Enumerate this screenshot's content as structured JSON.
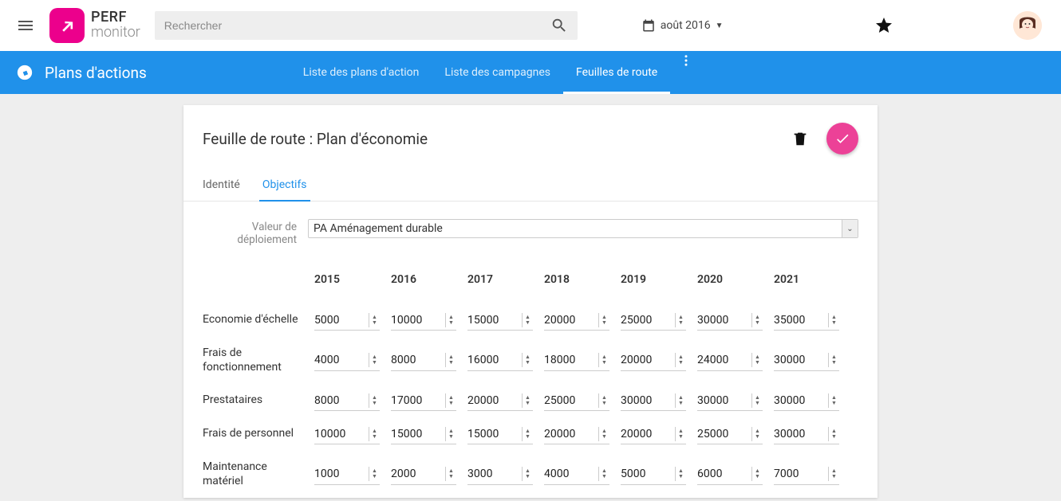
{
  "topbar": {
    "logo_line1": "PERF",
    "logo_line2": "monitor",
    "search_placeholder": "Rechercher",
    "date_label": "août 2016"
  },
  "navbar": {
    "title": "Plans d'actions",
    "tabs": [
      {
        "label": "Liste des plans d'action",
        "active": false
      },
      {
        "label": "Liste des campagnes",
        "active": false
      },
      {
        "label": "Feuilles de route",
        "active": true
      }
    ]
  },
  "card": {
    "title": "Feuille de route : Plan d'économie",
    "tabs": [
      {
        "label": "Identité",
        "active": false
      },
      {
        "label": "Objectifs",
        "active": true
      }
    ],
    "deployment_label": "Valeur de déploiement",
    "deployment_value": "PA Aménagement durable"
  },
  "table": {
    "years": [
      "2015",
      "2016",
      "2017",
      "2018",
      "2019",
      "2020",
      "2021"
    ],
    "rows": [
      {
        "label": "Economie d'échelle",
        "values": [
          "5000",
          "10000",
          "15000",
          "20000",
          "25000",
          "30000",
          "35000"
        ]
      },
      {
        "label": "Frais de fonctionnement",
        "values": [
          "4000",
          "8000",
          "16000",
          "18000",
          "20000",
          "24000",
          "30000"
        ]
      },
      {
        "label": "Prestataires",
        "values": [
          "8000",
          "17000",
          "20000",
          "25000",
          "30000",
          "30000",
          "30000"
        ]
      },
      {
        "label": "Frais de personnel",
        "values": [
          "10000",
          "15000",
          "15000",
          "20000",
          "20000",
          "25000",
          "30000"
        ]
      },
      {
        "label": "Maintenance matériel",
        "values": [
          "1000",
          "2000",
          "3000",
          "4000",
          "5000",
          "6000",
          "7000"
        ]
      }
    ]
  }
}
